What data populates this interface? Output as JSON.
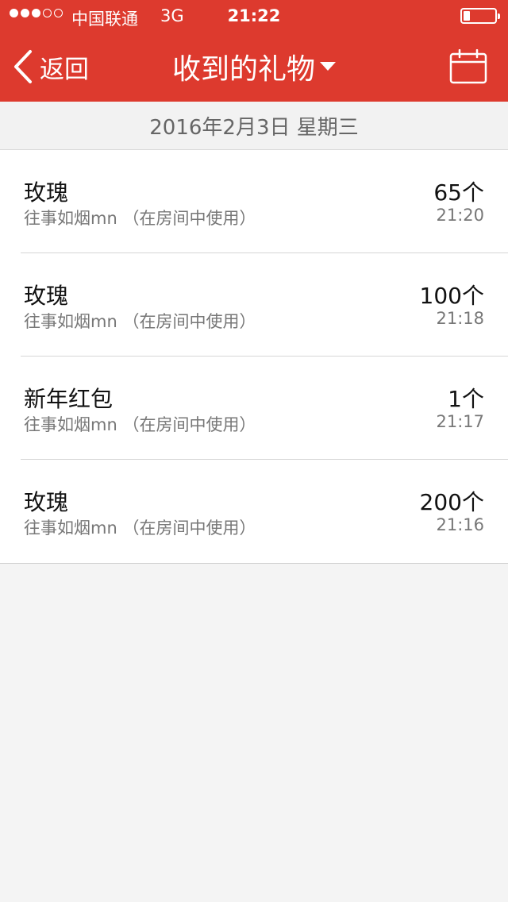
{
  "status_bar": {
    "signal_dots": [
      true,
      true,
      true,
      false,
      false
    ],
    "carrier": "中国联通",
    "network": "3G",
    "time": "21:22",
    "battery_level": 0.2
  },
  "nav": {
    "back_label": "返回",
    "title": "收到的礼物",
    "icons": {
      "back": "chevron-left-icon",
      "dropdown": "caret-down-icon",
      "calendar": "calendar-icon"
    }
  },
  "date_header": "2016年2月3日 星期三",
  "gifts": [
    {
      "name": "玫瑰",
      "sender": "往事如烟mn （在房间中使用）",
      "count": "65个",
      "time": "21:20"
    },
    {
      "name": "玫瑰",
      "sender": "往事如烟mn （在房间中使用）",
      "count": "100个",
      "time": "21:18"
    },
    {
      "name": "新年红包",
      "sender": "往事如烟mn （在房间中使用）",
      "count": "1个",
      "time": "21:17"
    },
    {
      "name": "玫瑰",
      "sender": "往事如烟mn （在房间中使用）",
      "count": "200个",
      "time": "21:16"
    }
  ],
  "colors": {
    "brand_red": "#dd3a2e",
    "background": "#f4f4f4"
  }
}
